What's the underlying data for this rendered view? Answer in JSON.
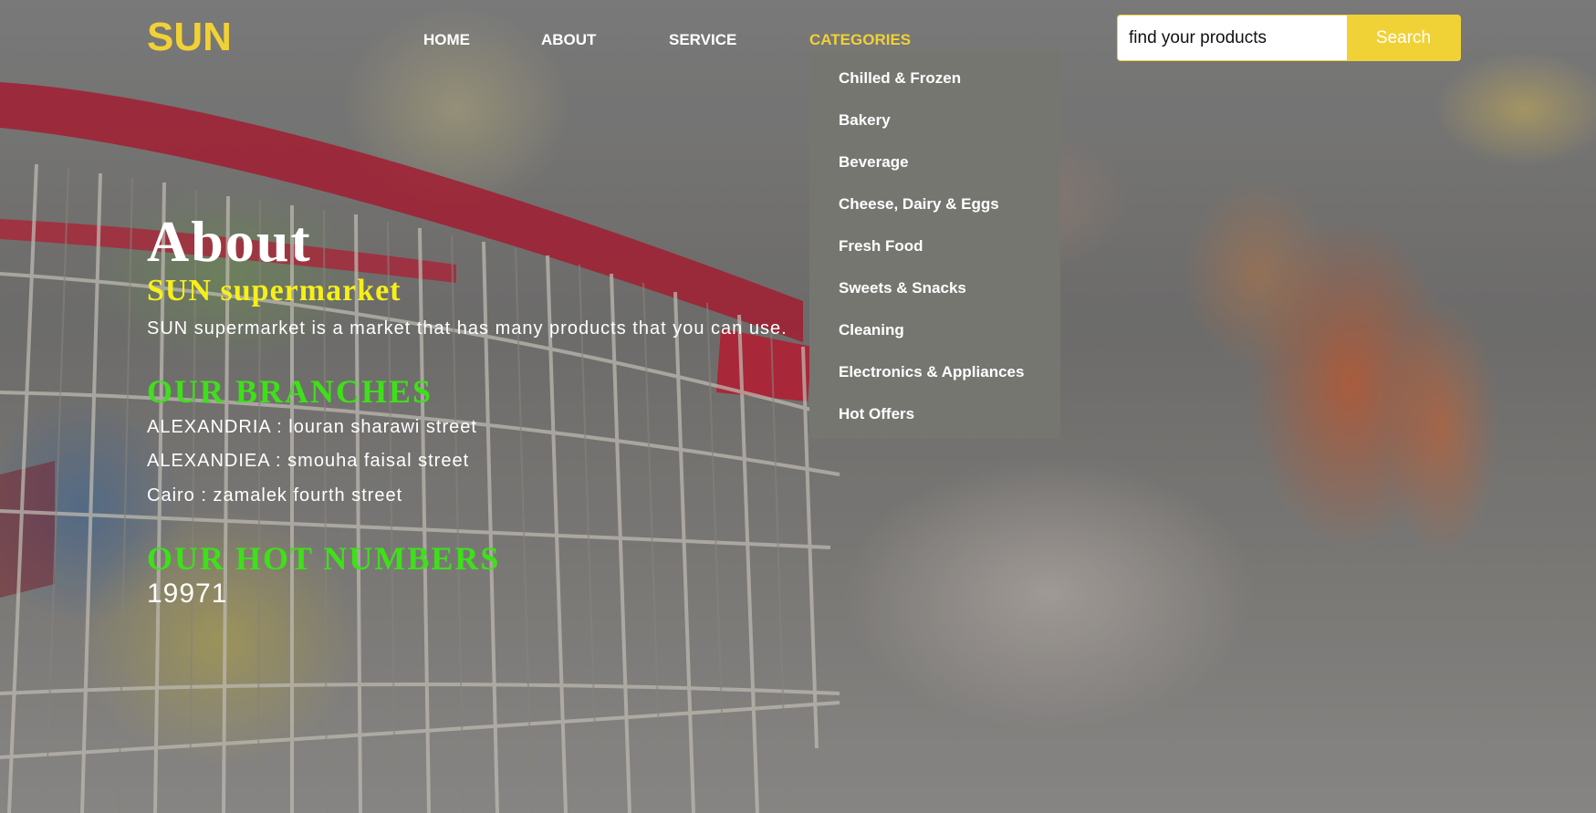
{
  "header": {
    "logo": "SUN",
    "nav": {
      "home": "HOME",
      "about": "ABOUT",
      "service": "SERVICE",
      "categories": "CATEGORIES"
    },
    "search": {
      "value": "find your products",
      "button_label": "Search"
    }
  },
  "categories_menu": {
    "items": [
      "Chilled & Frozen",
      "Bakery",
      "Beverage",
      "Cheese, Dairy & Eggs",
      "Fresh Food",
      "Sweets & Snacks",
      "Cleaning",
      "Electronics & Appliances",
      "Hot Offers"
    ]
  },
  "about": {
    "title": "About",
    "subtitle": "SUN supermarket",
    "description": "SUN supermarket is a market that has many products that you can use.",
    "branches_title": "OUR BRANCHES",
    "branches": [
      "ALEXANDRIA : louran sharawi street",
      "ALEXANDIEA : smouha faisal street",
      "Cairo : zamalek fourth street"
    ],
    "hot_title": "OUR HOT NUMBERS",
    "hot_number": "19971"
  },
  "colors": {
    "accent_yellow": "#f1d135",
    "subtitle_yellow": "#f6ef1a",
    "heading_green": "#3ee01a",
    "dropdown_bg": "#767671"
  }
}
